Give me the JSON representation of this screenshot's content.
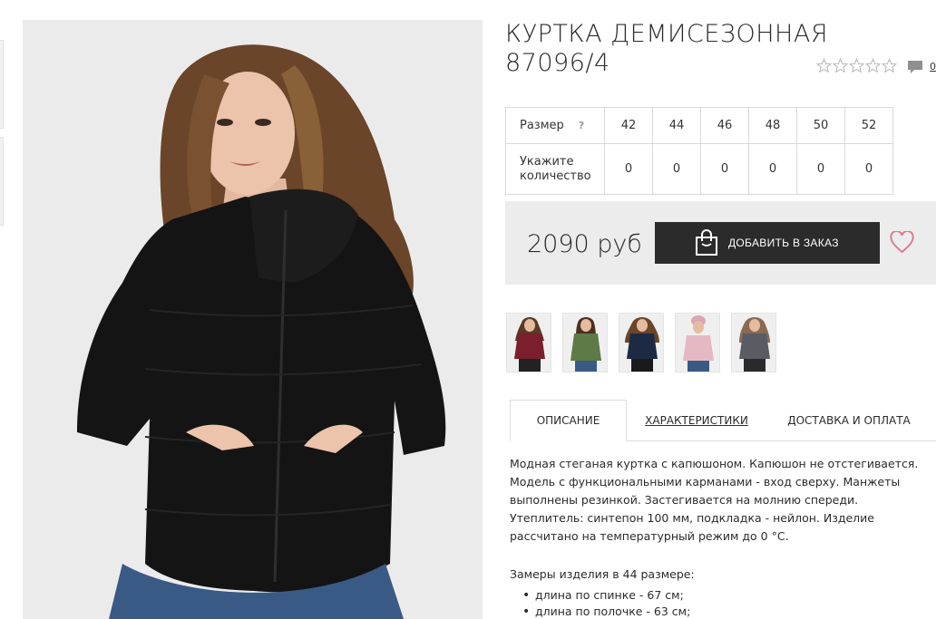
{
  "product": {
    "title_line1": "КУРТКА ДЕМИСЕЗОННАЯ",
    "title_line2": "87096/4",
    "rating_stars": 0,
    "rating_max": 5,
    "comments_count": "0"
  },
  "size_table": {
    "size_label": "Размер",
    "help_icon": "?",
    "qty_label_line1": "Укажите",
    "qty_label_line2": "количество",
    "sizes": [
      "42",
      "44",
      "46",
      "48",
      "50",
      "52"
    ],
    "quantities": [
      "0",
      "0",
      "0",
      "0",
      "0",
      "0"
    ]
  },
  "purchase": {
    "price": "2090 руб",
    "order_button_label": "ДОБАВИТЬ В ЗАКАЗ",
    "bag_icon": "shopping-bag-icon",
    "favorite_icon": "heart-icon"
  },
  "thumbnails": [
    {
      "name": "thumb-burgundy",
      "color": "#7a1f2b"
    },
    {
      "name": "thumb-khaki",
      "color": "#5e7a46"
    },
    {
      "name": "thumb-navy",
      "color": "#1d2a44"
    },
    {
      "name": "thumb-pink",
      "color": "#e4b9c3"
    },
    {
      "name": "thumb-grey",
      "color": "#5a5c63"
    }
  ],
  "tabs": {
    "description": "ОПИСАНИЕ",
    "specs": "ХАРАКТЕРИСТИКИ",
    "delivery": "ДОСТАВКА И ОПЛАТА",
    "active": "description"
  },
  "description": {
    "text": "Модная стеганая куртка с капюшоном. Капюшон не отстегивается. Модель с функциональными карманами - вход сверху. Манжеты выполнены резинкой. Застегивается на молнию спереди. Утеплитель: синтепон 100 мм, подкладка - нейлон. Изделие рассчитано на температурный режим до 0 °C.",
    "measures_title": "Замеры изделия в 44 размере:",
    "measures": [
      "длина по спинке - 67 см;",
      "длина по полочке - 63 см;"
    ]
  },
  "colors": {
    "button_bg": "#2b2b2b",
    "price_box_bg": "#ececec",
    "heart": "#d9798c",
    "jacket": "#141414"
  }
}
